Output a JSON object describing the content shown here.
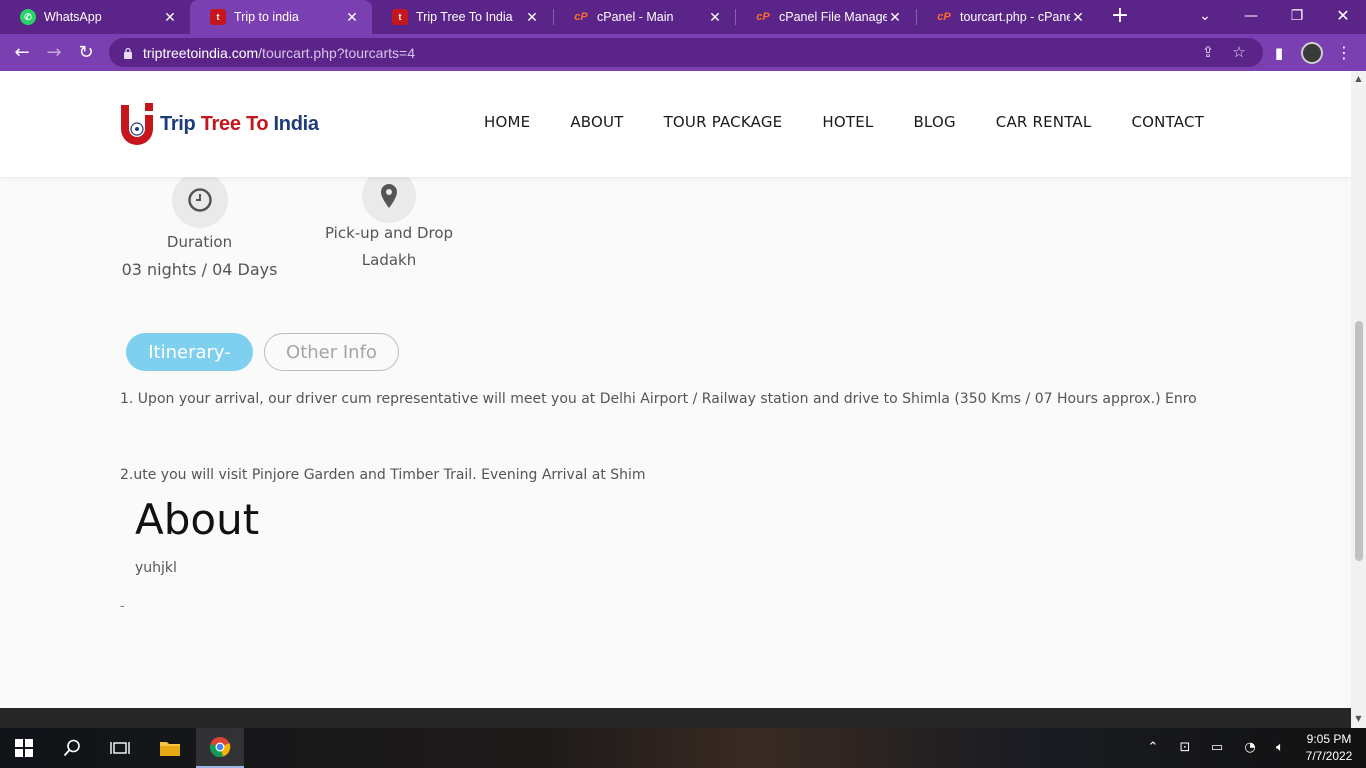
{
  "browser": {
    "tabs": [
      {
        "title": "WhatsApp",
        "icon": "whatsapp-icon",
        "active": false
      },
      {
        "title": "Trip to india",
        "icon": "site-logo-icon",
        "active": true
      },
      {
        "title": "Trip Tree To India",
        "icon": "site-logo-icon",
        "active": false
      },
      {
        "title": "cPanel - Main",
        "icon": "cpanel-icon",
        "active": false
      },
      {
        "title": "cPanel File Manager v",
        "icon": "cpanel-icon",
        "active": false
      },
      {
        "title": "tourcart.php - cPanel F",
        "icon": "cpanel-icon",
        "active": false
      }
    ],
    "new_tab": "+",
    "url_domain": "triptreetoindia.com",
    "url_path": "/tourcart.php?tourcarts=4",
    "accent_color": "#7a3fb0"
  },
  "site": {
    "logo": {
      "part1": "Trip ",
      "part2": "Tree ",
      "part3": "To ",
      "part4": "India"
    },
    "nav": [
      "HOME",
      "ABOUT",
      "TOUR PACKAGE",
      "HOTEL",
      "BLOG",
      "CAR RENTAL",
      "CONTACT"
    ],
    "features": [
      {
        "icon": "clock-icon",
        "label": "Duration",
        "value": "03 nights / 04 Days"
      },
      {
        "icon": "map-pin-icon",
        "label": "Pick-up and Drop",
        "value": "Ladakh"
      }
    ],
    "tabs": {
      "itinerary": "Itinerary-",
      "other": "Other Info"
    },
    "itinerary": [
      "1. Upon your arrival, our driver cum representative will meet you at Delhi Airport / Railway station and drive to Shimla (350 Kms / 07 Hours approx.) Enro",
      "2.ute you will visit Pinjore Garden and Timber Trail. Evening Arrival at Shim"
    ],
    "about_heading": "About",
    "about_text": "yuhjkl",
    "dash": "-"
  },
  "taskbar": {
    "time": "9:05 PM",
    "date": "7/7/2022"
  }
}
